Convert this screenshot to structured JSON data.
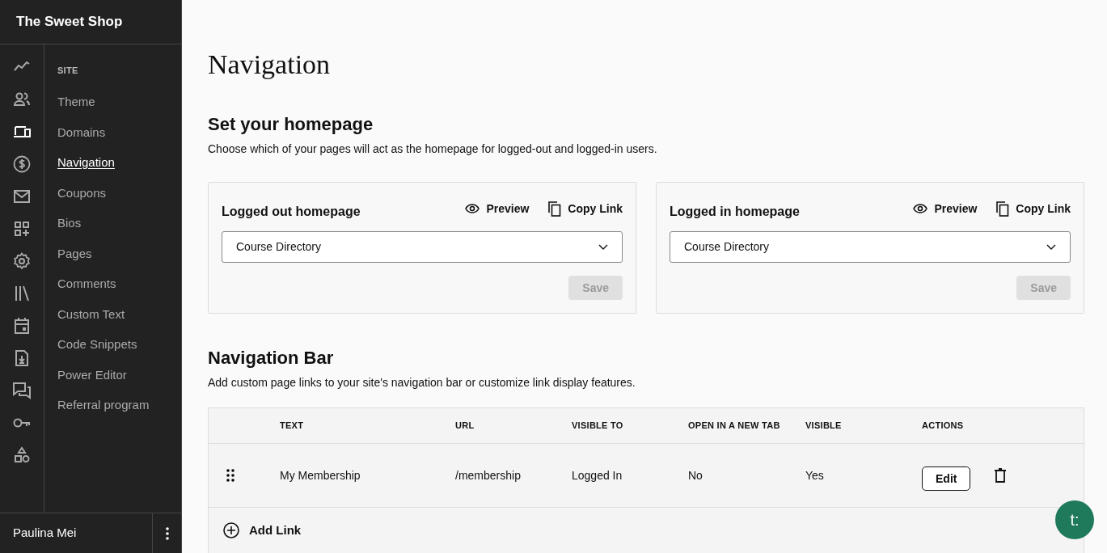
{
  "sidebar": {
    "site_name": "The Sweet Shop",
    "rail": [
      {
        "kind": "chart",
        "selected": false
      },
      {
        "kind": "people",
        "selected": false
      },
      {
        "kind": "devices",
        "selected": true
      },
      {
        "kind": "dollar",
        "selected": false
      },
      {
        "kind": "mail",
        "selected": false
      },
      {
        "kind": "apps",
        "selected": false
      },
      {
        "kind": "gear",
        "selected": false
      },
      {
        "kind": "library",
        "selected": false
      },
      {
        "kind": "calendar",
        "selected": false
      },
      {
        "kind": "download",
        "selected": false
      },
      {
        "kind": "chat",
        "selected": false
      },
      {
        "kind": "key",
        "selected": false
      },
      {
        "kind": "shapes",
        "selected": false
      }
    ],
    "section": "SITE",
    "items": [
      {
        "label": "Theme",
        "selected": false
      },
      {
        "label": "Domains",
        "selected": false
      },
      {
        "label": "Navigation",
        "selected": true
      },
      {
        "label": "Coupons",
        "selected": false
      },
      {
        "label": "Bios",
        "selected": false
      },
      {
        "label": "Pages",
        "selected": false
      },
      {
        "label": "Comments",
        "selected": false
      },
      {
        "label": "Custom Text",
        "selected": false
      },
      {
        "label": "Code Snippets",
        "selected": false
      },
      {
        "label": "Power Editor",
        "selected": false
      },
      {
        "label": "Referral program",
        "selected": false
      }
    ],
    "user": "Paulina Mei"
  },
  "page_title": "Navigation",
  "homepage": {
    "title": "Set your homepage",
    "description": "Choose which of your pages will act as the homepage for logged-out and logged-in users.",
    "cards": [
      {
        "title": "Logged out homepage",
        "preview": "Preview",
        "copy_link": "Copy Link",
        "value": "Course Directory",
        "save": "Save",
        "save_disabled": true
      },
      {
        "title": "Logged in homepage",
        "preview": "Preview",
        "copy_link": "Copy Link",
        "value": "Course Directory",
        "save": "Save",
        "save_disabled": true
      }
    ]
  },
  "nav_bar": {
    "title": "Navigation Bar",
    "description": "Add custom page links to your site's navigation bar or customize link display features.",
    "columns": [
      "TEXT",
      "URL",
      "VISIBLE TO",
      "OPEN IN A NEW TAB",
      "VISIBLE",
      "ACTIONS"
    ],
    "rows": [
      {
        "cells": [
          "My Membership",
          "/membership",
          "Logged In",
          "No",
          "Yes"
        ],
        "edit": "Edit"
      }
    ],
    "add_link": "Add Link"
  },
  "chat_button": "t:"
}
